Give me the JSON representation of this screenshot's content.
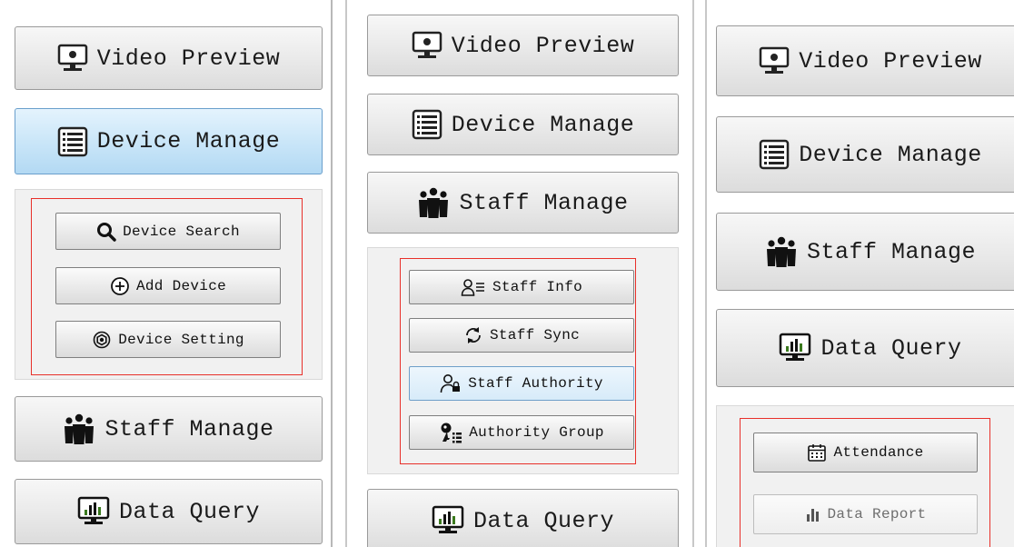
{
  "nav": {
    "video_preview": "Video Preview",
    "device_manage": "Device Manage",
    "staff_manage": "Staff Manage",
    "data_query": "Data Query"
  },
  "device_sub": {
    "device_search": "Device Search",
    "add_device": "Add Device",
    "device_setting": "Device Setting"
  },
  "staff_sub": {
    "staff_info": "Staff Info",
    "staff_sync": "Staff Sync",
    "staff_authority": "Staff Authority",
    "authority_group": "Authority Group"
  },
  "query_sub": {
    "attendance": "Attendance",
    "data_report": "Data Report"
  },
  "colors": {
    "active_blue": "#c8e5f8",
    "highlight_red": "#e8302a",
    "icon_green": "#3b7a1e"
  }
}
